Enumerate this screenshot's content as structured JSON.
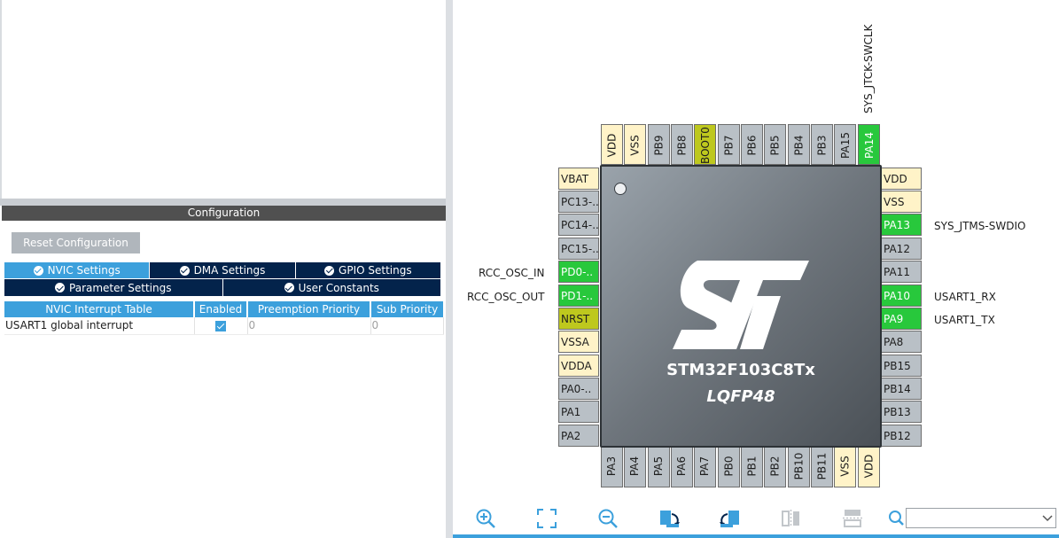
{
  "configuration": {
    "title": "Configuration",
    "reset_label": "Reset Configuration",
    "tabs_row1": [
      {
        "label": "NVIC Settings",
        "active": true
      },
      {
        "label": "DMA Settings",
        "active": false
      },
      {
        "label": "GPIO Settings",
        "active": false
      }
    ],
    "tabs_row2": [
      {
        "label": "Parameter Settings",
        "active": false
      },
      {
        "label": "User Constants",
        "active": false
      }
    ],
    "table": {
      "headers": [
        "NVIC Interrupt Table",
        "Enabled",
        "Preemption Priority",
        "Sub Priority"
      ],
      "rows": [
        {
          "name": "USART1 global interrupt",
          "enabled": true,
          "preemption": "0",
          "sub": "0"
        }
      ]
    }
  },
  "chip": {
    "name": "STM32F103C8Tx",
    "package": "LQFP48"
  },
  "pins": {
    "top": [
      "VDD",
      "VSS",
      "PB9",
      "PB8",
      "BOOT0",
      "PB7",
      "PB6",
      "PB5",
      "PB4",
      "PB3",
      "PA15",
      "PA14"
    ],
    "left": [
      "VBAT",
      "PC13-..",
      "PC14-..",
      "PC15-..",
      "PD0-..",
      "PD1-..",
      "NRST",
      "VSSA",
      "VDDA",
      "PA0-..",
      "PA1",
      "PA2"
    ],
    "right": [
      "VDD",
      "VSS",
      "PA13",
      "PA12",
      "PA11",
      "PA10",
      "PA9",
      "PA8",
      "PB15",
      "PB14",
      "PB13",
      "PB12"
    ],
    "bottom": [
      "PA3",
      "PA4",
      "PA5",
      "PA6",
      "PA7",
      "PB0",
      "PB1",
      "PB2",
      "PB10",
      "PB11",
      "VSS",
      "VDD"
    ]
  },
  "pin_colors": {
    "power": "#fff3c8",
    "default": "#b9c0c6",
    "assigned": "#28c83c",
    "special": "#bec81e"
  },
  "signals": {
    "PA14": "SYS_JTCK-SWCLK",
    "PA13": "SYS_JTMS-SWDIO",
    "PA10": "USART1_RX",
    "PA9": "USART1_TX",
    "PD0": "RCC_OSC_IN",
    "PD1": "RCC_OSC_OUT"
  },
  "toolbar": {
    "icons": [
      "zoom-in-icon",
      "fit-to-window-icon",
      "zoom-out-icon",
      "rotate-right-icon",
      "rotate-left-icon",
      "flip-vertical-icon",
      "flip-horizontal-icon",
      "search-icon"
    ],
    "search_value": ""
  },
  "colors": {
    "accent": "#3ca0dc",
    "dark_tab": "#03234b",
    "title_bar": "#505050"
  }
}
